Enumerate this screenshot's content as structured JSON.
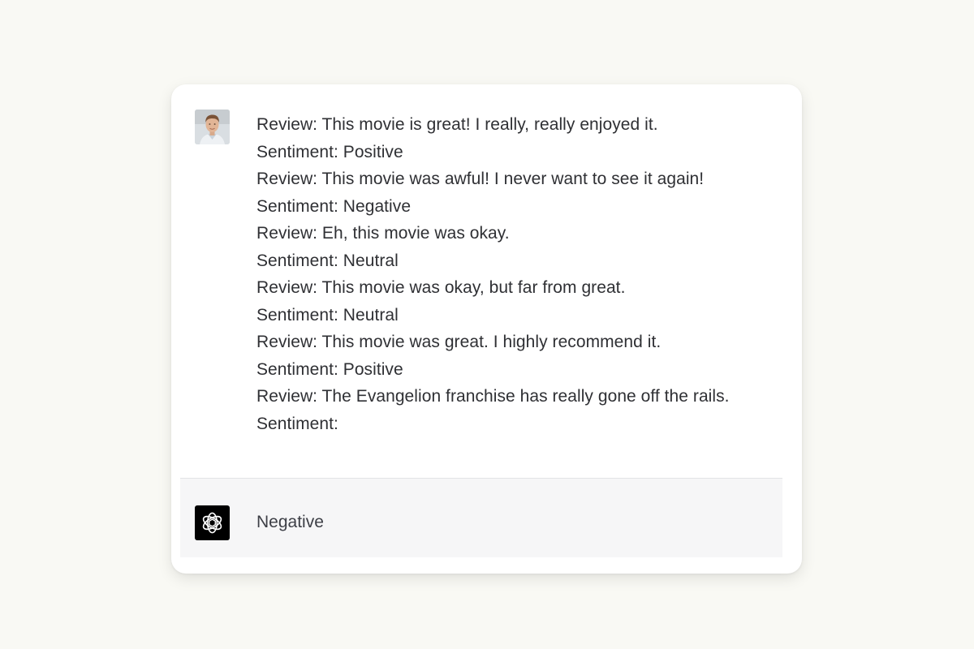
{
  "conversation": {
    "user": {
      "avatar_icon": "user-avatar-photo",
      "lines": [
        "Review: This movie is great! I really, really enjoyed it.",
        "Sentiment: Positive",
        "Review: This movie was awful! I never want to see it again!",
        "Sentiment: Negative",
        "Review: Eh, this movie was okay.",
        "Sentiment: Neutral",
        "Review: This movie was okay, but far from great.",
        "Sentiment: Neutral",
        "Review: This movie was great. I highly recommend it.",
        "Sentiment: Positive",
        "Review: The Evangelion franchise has really gone off the rails.",
        "Sentiment:"
      ]
    },
    "assistant": {
      "avatar_icon": "openai-logo-icon",
      "text": "Negative"
    }
  },
  "colors": {
    "page_background": "#f9f9f4",
    "card_background": "#ffffff",
    "response_background": "#f6f6f7",
    "text": "#2f3034",
    "bot_avatar_background": "#000000"
  }
}
